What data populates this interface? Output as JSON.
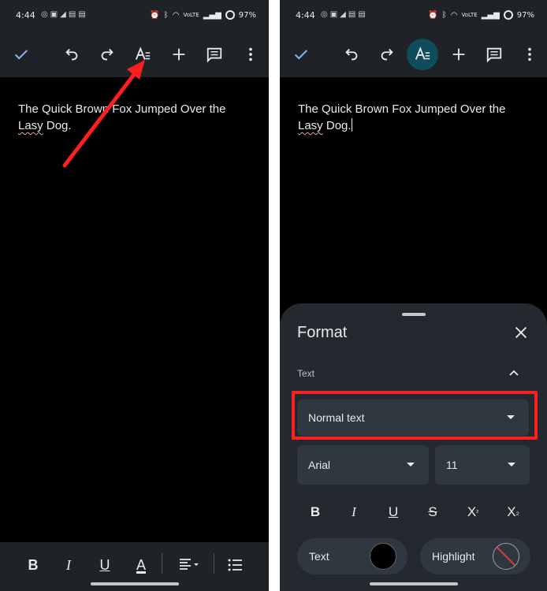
{
  "status_bar": {
    "time": "4:44",
    "battery": "97%",
    "network": "VoLTE"
  },
  "document": {
    "line1": "The Quick Brown Fox Jumped Over the",
    "misspelled_word": "Lasy",
    "line2_rest": " Dog."
  },
  "toolbar": {
    "icons": [
      "check-icon",
      "undo-icon",
      "redo-icon",
      "text-format-icon",
      "add-icon",
      "comment-icon",
      "more-vert-icon"
    ]
  },
  "bottom_toolbar": {
    "bold": "B",
    "italic": "I",
    "underline": "U",
    "text_color": "A"
  },
  "format_panel": {
    "title": "Format",
    "section": "Text",
    "paragraph_style": "Normal text",
    "font": "Arial",
    "font_size": "11",
    "bold": "B",
    "italic": "I",
    "underline": "U",
    "strikethrough": "S",
    "superscript": "X",
    "superscript_mark": "²",
    "subscript": "X",
    "subscript_mark": "₂",
    "text_color_label": "Text",
    "highlight_label": "Highlight",
    "text_color_value": "#000000"
  },
  "annotation_color": "#ff1e1e"
}
